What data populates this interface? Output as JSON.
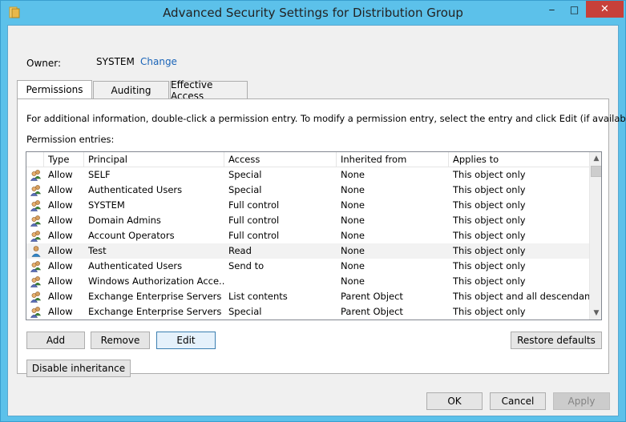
{
  "window": {
    "title": "Advanced Security Settings for Distribution Group",
    "minimize_glyph": "‒",
    "maximize_glyph": "□",
    "close_glyph": "✕"
  },
  "owner": {
    "label": "Owner:",
    "value": "SYSTEM",
    "change_link": "Change"
  },
  "tabs": [
    {
      "label": "Permissions",
      "active": true
    },
    {
      "label": "Auditing",
      "active": false
    },
    {
      "label": "Effective Access",
      "active": false
    }
  ],
  "permissions": {
    "info_text": "For additional information, double-click a permission entry. To modify a permission entry, select the entry and click Edit (if available).",
    "entries_label": "Permission entries:",
    "columns": [
      "Type",
      "Principal",
      "Access",
      "Inherited from",
      "Applies to"
    ],
    "rows": [
      {
        "icon": "group-icon",
        "type": "Allow",
        "principal": "SELF",
        "access": "Special",
        "inherited_from": "None",
        "applies_to": "This object only"
      },
      {
        "icon": "group-icon",
        "type": "Allow",
        "principal": "Authenticated Users",
        "access": "Special",
        "inherited_from": "None",
        "applies_to": "This object only"
      },
      {
        "icon": "group-icon",
        "type": "Allow",
        "principal": "SYSTEM",
        "access": "Full control",
        "inherited_from": "None",
        "applies_to": "This object only"
      },
      {
        "icon": "group-icon",
        "type": "Allow",
        "principal": "Domain Admins",
        "access": "Full control",
        "inherited_from": "None",
        "applies_to": "This object only"
      },
      {
        "icon": "group-icon",
        "type": "Allow",
        "principal": "Account Operators",
        "access": "Full control",
        "inherited_from": "None",
        "applies_to": "This object only"
      },
      {
        "icon": "user-icon",
        "type": "Allow",
        "principal": "Test",
        "access": "Read",
        "inherited_from": "None",
        "applies_to": "This object only"
      },
      {
        "icon": "group-icon",
        "type": "Allow",
        "principal": "Authenticated Users",
        "access": "Send to",
        "inherited_from": "None",
        "applies_to": "This object only"
      },
      {
        "icon": "group-icon",
        "type": "Allow",
        "principal": "Windows Authorization Acce...",
        "access": "",
        "inherited_from": "None",
        "applies_to": "This object only"
      },
      {
        "icon": "group-icon",
        "type": "Allow",
        "principal": "Exchange Enterprise Servers (...",
        "access": "List contents",
        "inherited_from": "Parent Object",
        "applies_to": "This object and all descendan..."
      },
      {
        "icon": "group-icon",
        "type": "Allow",
        "principal": "Exchange Enterprise Servers (...",
        "access": "Special",
        "inherited_from": "Parent Object",
        "applies_to": "This object only"
      }
    ]
  },
  "buttons": {
    "add": "Add",
    "remove": "Remove",
    "edit": "Edit",
    "restore_defaults": "Restore defaults",
    "disable_inheritance": "Disable inheritance",
    "ok": "OK",
    "cancel": "Cancel",
    "apply": "Apply"
  },
  "colors": {
    "titlebar": "#5cc1ea",
    "close_button": "#c7403a",
    "link": "#1a64b8"
  }
}
